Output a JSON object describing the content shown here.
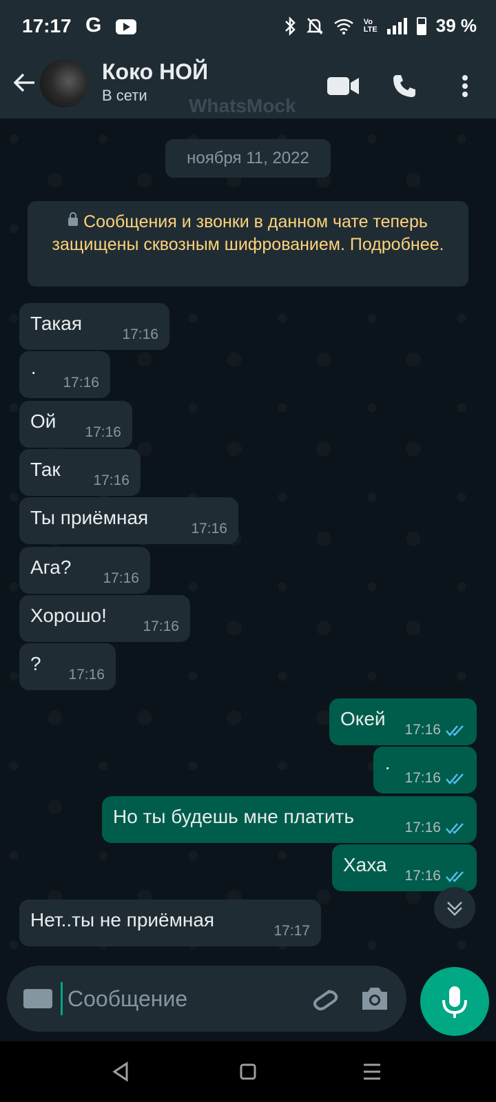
{
  "status_bar": {
    "time": "17:17",
    "battery": "39 %",
    "icons": [
      "google-icon",
      "youtube-icon",
      "bluetooth-icon",
      "bell-off-icon",
      "wifi-icon",
      "volte-icon",
      "signal-icon",
      "battery-icon"
    ]
  },
  "header": {
    "contact_name": "Коко НОЙ",
    "status": "В сети",
    "watermark": "WhatsMock",
    "icons": [
      "back-arrow-icon",
      "video-call-icon",
      "phone-icon",
      "more-vert-icon"
    ]
  },
  "chat": {
    "date_chip": "ноября 11, 2022",
    "encryption_notice": "Сообщения и звонки в данном чате теперь защищены сквозным шифрованием. Подробнее.",
    "messages": [
      {
        "direction": "in",
        "text": "Такая",
        "time": "17:16"
      },
      {
        "direction": "in",
        "text": "·",
        "time": "17:16"
      },
      {
        "direction": "in",
        "text": "Ой",
        "time": "17:16"
      },
      {
        "direction": "in",
        "text": "Так",
        "time": "17:16"
      },
      {
        "direction": "in",
        "text": "Ты приёмная",
        "time": "17:16"
      },
      {
        "direction": "in",
        "text": "Ага?",
        "time": "17:16"
      },
      {
        "direction": "in",
        "text": "Хорошо!",
        "time": "17:16"
      },
      {
        "direction": "in",
        "text": "?",
        "time": "17:16"
      },
      {
        "direction": "out",
        "text": "Окей",
        "time": "17:16",
        "read": true
      },
      {
        "direction": "out",
        "text": "·",
        "time": "17:16",
        "read": true
      },
      {
        "direction": "out",
        "text": "Но ты будешь мне платить",
        "time": "17:16",
        "read": true
      },
      {
        "direction": "out",
        "text": "Хаха",
        "time": "17:16",
        "read": true
      },
      {
        "direction": "in",
        "text": "Нет..ты не приёмная",
        "time": "17:17"
      }
    ]
  },
  "composer": {
    "placeholder": "Сообщение",
    "icons": [
      "keyboard-icon",
      "attach-icon",
      "camera-icon",
      "mic-icon"
    ]
  },
  "colors": {
    "background": "#0b141a",
    "header": "#1f2c34",
    "incoming_bubble": "#202c33",
    "outgoing_bubble": "#005c4b",
    "accent": "#00a884",
    "read_ticks": "#53bdeb",
    "notice_text": "#ffd279"
  }
}
